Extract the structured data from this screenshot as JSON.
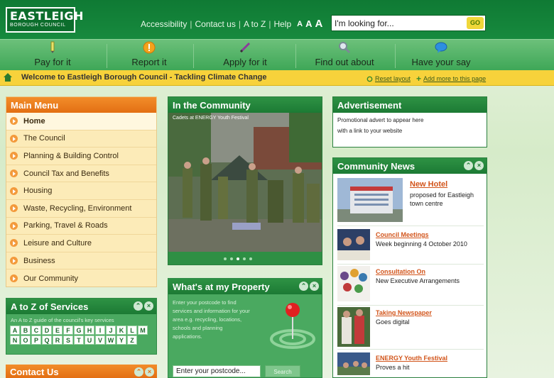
{
  "header": {
    "logo_line1": "EASTLEIGH",
    "logo_line2": "BOROUGH COUNCIL",
    "links": [
      "Accessibility",
      "Contact us",
      "A to Z",
      "Help"
    ],
    "text_size": [
      "A",
      "A",
      "A"
    ],
    "search_placeholder": "I'm looking for...",
    "search_button": "GO"
  },
  "nav": [
    {
      "label": "Pay for it",
      "icon": "pencil-icon"
    },
    {
      "label": "Report it",
      "icon": "alert-icon"
    },
    {
      "label": "Apply for it",
      "icon": "pen-icon"
    },
    {
      "label": "Find out about",
      "icon": "magnifier-icon"
    },
    {
      "label": "Have your say",
      "icon": "speech-bubble-icon"
    }
  ],
  "welcome": {
    "text": "Welcome to Eastleigh Borough Council - Tackling Climate Change",
    "reset": "Reset layout",
    "add": "Add more to this page"
  },
  "main_menu": {
    "title": "Main Menu",
    "items": [
      "Home",
      "The Council",
      "Planning & Building Control",
      "Council Tax and Benefits",
      "Housing",
      "Waste, Recycling, Environment",
      "Parking, Travel & Roads",
      "Leisure and Culture",
      "Business",
      "Our Community"
    ]
  },
  "atoz": {
    "title": "A to Z of Services",
    "desc": "An A to Z guide of the council's key services",
    "letters": [
      "A",
      "B",
      "C",
      "D",
      "E",
      "F",
      "G",
      "H",
      "I",
      "J",
      "K",
      "L",
      "M",
      "N",
      "O",
      "P",
      "Q",
      "R",
      "S",
      "T",
      "U",
      "V",
      "W",
      "Y",
      "Z"
    ]
  },
  "contact": {
    "title": "Contact Us"
  },
  "community": {
    "title": "In the Community",
    "caption": "Cadets at ENERGY Youth Festival"
  },
  "property": {
    "title": "What's at my Property",
    "desc": "Enter your postcode to find services and information for your area e.g. recycling, locations, schools and planning applications.",
    "placeholder": "Enter your postcode...",
    "button": "Search"
  },
  "advert": {
    "title": "Advertisement",
    "line1": "Promotional advert to appear here",
    "line2": "with a link to your website"
  },
  "news": {
    "title": "Community News",
    "items": [
      {
        "title": "New Hotel",
        "sub": "proposed for Eastleigh town centre"
      },
      {
        "title": "Council Meetings",
        "sub": "Week beginning 4 October 2010"
      },
      {
        "title": "Consultation On",
        "sub": "New Executive Arrangements"
      },
      {
        "title": "Taking Newspaper",
        "sub": "Goes digital"
      },
      {
        "title": "ENERGY Youth Festival",
        "sub": "Proves a hit"
      }
    ]
  }
}
